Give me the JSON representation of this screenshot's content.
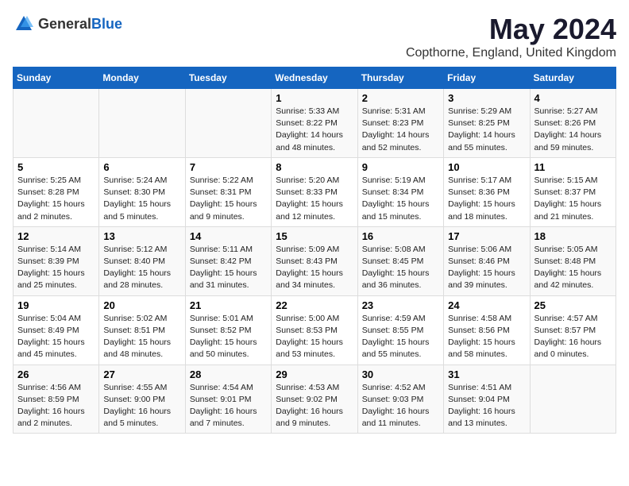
{
  "logo": {
    "general": "General",
    "blue": "Blue"
  },
  "title": "May 2024",
  "subtitle": "Copthorne, England, United Kingdom",
  "days_header": [
    "Sunday",
    "Monday",
    "Tuesday",
    "Wednesday",
    "Thursday",
    "Friday",
    "Saturday"
  ],
  "weeks": [
    [
      {
        "day": "",
        "info": ""
      },
      {
        "day": "",
        "info": ""
      },
      {
        "day": "",
        "info": ""
      },
      {
        "day": "1",
        "info": "Sunrise: 5:33 AM\nSunset: 8:22 PM\nDaylight: 14 hours and 48 minutes."
      },
      {
        "day": "2",
        "info": "Sunrise: 5:31 AM\nSunset: 8:23 PM\nDaylight: 14 hours and 52 minutes."
      },
      {
        "day": "3",
        "info": "Sunrise: 5:29 AM\nSunset: 8:25 PM\nDaylight: 14 hours and 55 minutes."
      },
      {
        "day": "4",
        "info": "Sunrise: 5:27 AM\nSunset: 8:26 PM\nDaylight: 14 hours and 59 minutes."
      }
    ],
    [
      {
        "day": "5",
        "info": "Sunrise: 5:25 AM\nSunset: 8:28 PM\nDaylight: 15 hours and 2 minutes."
      },
      {
        "day": "6",
        "info": "Sunrise: 5:24 AM\nSunset: 8:30 PM\nDaylight: 15 hours and 5 minutes."
      },
      {
        "day": "7",
        "info": "Sunrise: 5:22 AM\nSunset: 8:31 PM\nDaylight: 15 hours and 9 minutes."
      },
      {
        "day": "8",
        "info": "Sunrise: 5:20 AM\nSunset: 8:33 PM\nDaylight: 15 hours and 12 minutes."
      },
      {
        "day": "9",
        "info": "Sunrise: 5:19 AM\nSunset: 8:34 PM\nDaylight: 15 hours and 15 minutes."
      },
      {
        "day": "10",
        "info": "Sunrise: 5:17 AM\nSunset: 8:36 PM\nDaylight: 15 hours and 18 minutes."
      },
      {
        "day": "11",
        "info": "Sunrise: 5:15 AM\nSunset: 8:37 PM\nDaylight: 15 hours and 21 minutes."
      }
    ],
    [
      {
        "day": "12",
        "info": "Sunrise: 5:14 AM\nSunset: 8:39 PM\nDaylight: 15 hours and 25 minutes."
      },
      {
        "day": "13",
        "info": "Sunrise: 5:12 AM\nSunset: 8:40 PM\nDaylight: 15 hours and 28 minutes."
      },
      {
        "day": "14",
        "info": "Sunrise: 5:11 AM\nSunset: 8:42 PM\nDaylight: 15 hours and 31 minutes."
      },
      {
        "day": "15",
        "info": "Sunrise: 5:09 AM\nSunset: 8:43 PM\nDaylight: 15 hours and 34 minutes."
      },
      {
        "day": "16",
        "info": "Sunrise: 5:08 AM\nSunset: 8:45 PM\nDaylight: 15 hours and 36 minutes."
      },
      {
        "day": "17",
        "info": "Sunrise: 5:06 AM\nSunset: 8:46 PM\nDaylight: 15 hours and 39 minutes."
      },
      {
        "day": "18",
        "info": "Sunrise: 5:05 AM\nSunset: 8:48 PM\nDaylight: 15 hours and 42 minutes."
      }
    ],
    [
      {
        "day": "19",
        "info": "Sunrise: 5:04 AM\nSunset: 8:49 PM\nDaylight: 15 hours and 45 minutes."
      },
      {
        "day": "20",
        "info": "Sunrise: 5:02 AM\nSunset: 8:51 PM\nDaylight: 15 hours and 48 minutes."
      },
      {
        "day": "21",
        "info": "Sunrise: 5:01 AM\nSunset: 8:52 PM\nDaylight: 15 hours and 50 minutes."
      },
      {
        "day": "22",
        "info": "Sunrise: 5:00 AM\nSunset: 8:53 PM\nDaylight: 15 hours and 53 minutes."
      },
      {
        "day": "23",
        "info": "Sunrise: 4:59 AM\nSunset: 8:55 PM\nDaylight: 15 hours and 55 minutes."
      },
      {
        "day": "24",
        "info": "Sunrise: 4:58 AM\nSunset: 8:56 PM\nDaylight: 15 hours and 58 minutes."
      },
      {
        "day": "25",
        "info": "Sunrise: 4:57 AM\nSunset: 8:57 PM\nDaylight: 16 hours and 0 minutes."
      }
    ],
    [
      {
        "day": "26",
        "info": "Sunrise: 4:56 AM\nSunset: 8:59 PM\nDaylight: 16 hours and 2 minutes."
      },
      {
        "day": "27",
        "info": "Sunrise: 4:55 AM\nSunset: 9:00 PM\nDaylight: 16 hours and 5 minutes."
      },
      {
        "day": "28",
        "info": "Sunrise: 4:54 AM\nSunset: 9:01 PM\nDaylight: 16 hours and 7 minutes."
      },
      {
        "day": "29",
        "info": "Sunrise: 4:53 AM\nSunset: 9:02 PM\nDaylight: 16 hours and 9 minutes."
      },
      {
        "day": "30",
        "info": "Sunrise: 4:52 AM\nSunset: 9:03 PM\nDaylight: 16 hours and 11 minutes."
      },
      {
        "day": "31",
        "info": "Sunrise: 4:51 AM\nSunset: 9:04 PM\nDaylight: 16 hours and 13 minutes."
      },
      {
        "day": "",
        "info": ""
      }
    ]
  ]
}
